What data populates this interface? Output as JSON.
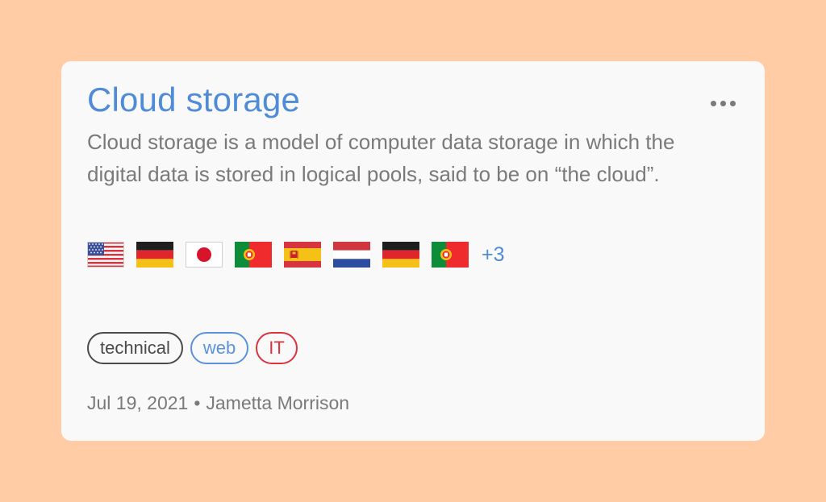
{
  "colors": {
    "background": "#FFCCA6",
    "card": "#F9F9F9",
    "title": "#4F8BD6",
    "text_gray": "#7A7A7A",
    "dots": "#7A7A7A",
    "tag_technical": "#4A4A4A",
    "tag_web": "#5A93DB",
    "tag_it": "#D8343F",
    "more_count": "#4F8BD6"
  },
  "card": {
    "title": "Cloud storage",
    "more_icon": "more-horizontal-icon",
    "description": "Cloud storage is a model of computer data storage in which the digital data is stored in logical pools, said to be on “the cloud”.",
    "flags": [
      {
        "icon": "flag-us-icon"
      },
      {
        "icon": "flag-de-icon"
      },
      {
        "icon": "flag-jp-icon"
      },
      {
        "icon": "flag-pt-icon"
      },
      {
        "icon": "flag-es-icon"
      },
      {
        "icon": "flag-nl-icon"
      },
      {
        "icon": "flag-de-icon"
      },
      {
        "icon": "flag-pt-icon"
      }
    ],
    "more_flags": "+3",
    "tags": [
      {
        "label": "technical",
        "color": "#4A4A4A"
      },
      {
        "label": "web",
        "color": "#5A93DB"
      },
      {
        "label": "IT",
        "color": "#D8343F"
      }
    ],
    "date": "Jul 19, 2021",
    "separator": "•",
    "author": "Jametta Morrison"
  }
}
